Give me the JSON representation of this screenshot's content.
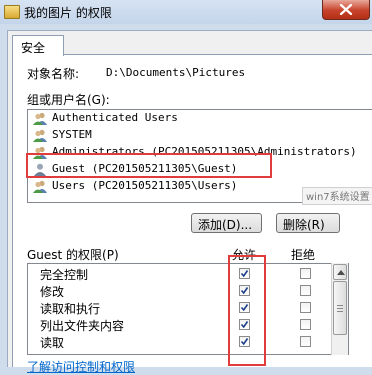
{
  "window": {
    "title": "我的图片 的权限",
    "close_label": "close",
    "icon": "folder-icon"
  },
  "tabs": [
    "安全"
  ],
  "object": {
    "label": "对象名称:",
    "value": "D:\\Documents\\Pictures"
  },
  "groups": {
    "label": "组或用户名(G):",
    "items": [
      {
        "name": "Authenticated Users",
        "icon": "users-icon"
      },
      {
        "name": "SYSTEM",
        "icon": "users-icon"
      },
      {
        "name": "Administrators (PC201505211305\\Administrators)",
        "icon": "users-icon"
      },
      {
        "name": "Guest (PC201505211305\\Guest)",
        "icon": "user-icon",
        "selected": true
      },
      {
        "name": "Users (PC201505211305\\Users)",
        "icon": "users-icon"
      }
    ]
  },
  "watermark": "win7系统设置",
  "buttons": {
    "add": "添加(D)...",
    "remove": "删除(R)"
  },
  "permissions": {
    "label": "Guest 的权限(P)",
    "allow_header": "允许",
    "deny_header": "拒绝",
    "rows": [
      {
        "name": "完全控制",
        "allow": true,
        "deny": false
      },
      {
        "name": "修改",
        "allow": true,
        "deny": false
      },
      {
        "name": "读取和执行",
        "allow": true,
        "deny": false
      },
      {
        "name": "列出文件夹内容",
        "allow": true,
        "deny": false
      },
      {
        "name": "读取",
        "allow": true,
        "deny": false
      }
    ]
  },
  "link": "了解访问控制和权限",
  "colors": {
    "highlight_border": "#e03c3c",
    "link": "#0066cc",
    "title_bar": "#c4d5ea"
  }
}
